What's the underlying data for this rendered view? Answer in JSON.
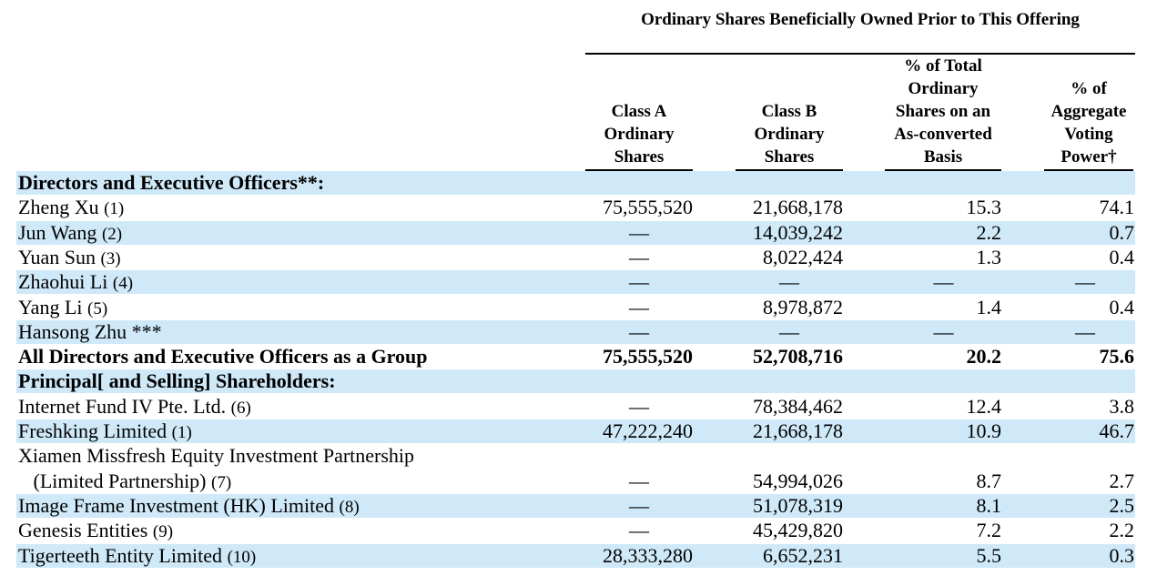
{
  "header": {
    "group_title": "Ordinary Shares Beneficially Owned Prior to This Offering",
    "columns": [
      "Class A Ordinary Shares",
      "Class B Ordinary Shares",
      "% of Total Ordinary Shares on an As-converted Basis",
      "% of Aggregate Voting Power†"
    ]
  },
  "rows": [
    {
      "label": "Directors and Executive Officers**:",
      "fn": "",
      "values": [
        "",
        "",
        "",
        ""
      ],
      "bold": true,
      "shaded": true
    },
    {
      "label": "Zheng Xu",
      "fn": "(1)",
      "values": [
        "75,555,520",
        "21,668,178",
        "15.3",
        "74.1"
      ],
      "bold": false,
      "shaded": false
    },
    {
      "label": "Jun Wang",
      "fn": "(2)",
      "values": [
        "—",
        "14,039,242",
        "2.2",
        "0.7"
      ],
      "bold": false,
      "shaded": true
    },
    {
      "label": "Yuan Sun",
      "fn": "(3)",
      "values": [
        "—",
        "8,022,424",
        "1.3",
        "0.4"
      ],
      "bold": false,
      "shaded": false
    },
    {
      "label": "Zhaohui Li",
      "fn": "(4)",
      "values": [
        "—",
        "—",
        "—",
        "—"
      ],
      "bold": false,
      "shaded": true
    },
    {
      "label": "Yang Li",
      "fn": "(5)",
      "values": [
        "—",
        "8,978,872",
        "1.4",
        "0.4"
      ],
      "bold": false,
      "shaded": false
    },
    {
      "label": "Hansong Zhu ***",
      "fn": "",
      "values": [
        "—",
        "—",
        "—",
        "—"
      ],
      "bold": false,
      "shaded": true
    },
    {
      "label": "All Directors and Executive Officers as a Group",
      "fn": "",
      "values": [
        "75,555,520",
        "52,708,716",
        "20.2",
        "75.6"
      ],
      "bold": true,
      "shaded": false
    },
    {
      "label": "Principal[ and Selling] Shareholders:",
      "fn": "",
      "values": [
        "",
        "",
        "",
        ""
      ],
      "bold": true,
      "shaded": true
    },
    {
      "label": "Internet Fund IV Pte. Ltd.",
      "fn": "(6)",
      "values": [
        "—",
        "78,384,462",
        "12.4",
        "3.8"
      ],
      "bold": false,
      "shaded": false
    },
    {
      "label": "Freshking Limited",
      "fn": "(1)",
      "values": [
        "47,222,240",
        "21,668,178",
        "10.9",
        "46.7"
      ],
      "bold": false,
      "shaded": true
    },
    {
      "label": "Xiamen Missfresh Equity Investment Partnership",
      "fn": "",
      "values": [
        "",
        "",
        "",
        ""
      ],
      "bold": false,
      "shaded": false
    },
    {
      "label": "   (Limited Partnership)",
      "fn": "(7)",
      "values": [
        "—",
        "54,994,026",
        "8.7",
        "2.7"
      ],
      "bold": false,
      "shaded": false
    },
    {
      "label": "Image Frame Investment (HK) Limited",
      "fn": "(8)",
      "values": [
        "—",
        "51,078,319",
        "8.1",
        "2.5"
      ],
      "bold": false,
      "shaded": true
    },
    {
      "label": "Genesis Entities",
      "fn": "(9)",
      "values": [
        "—",
        "45,429,820",
        "7.2",
        "2.2"
      ],
      "bold": false,
      "shaded": false
    },
    {
      "label": "Tigerteeth Entity Limited",
      "fn": "(10)",
      "values": [
        "28,333,280",
        "6,652,231",
        "5.5",
        "0.3"
      ],
      "bold": false,
      "shaded": true
    }
  ]
}
